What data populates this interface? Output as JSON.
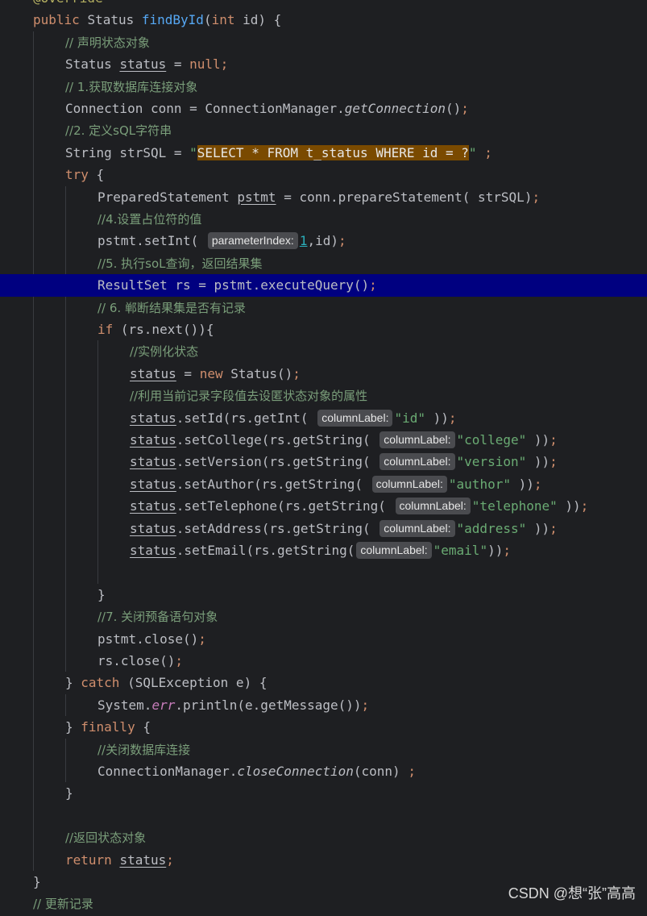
{
  "editor": {
    "lines": [
      {
        "indent": 0,
        "tokens": [
          {
            "t": "@Override",
            "c": "ann"
          }
        ]
      },
      {
        "indent": 0,
        "tokens": [
          {
            "t": "public ",
            "c": "kw"
          },
          {
            "t": "Status "
          },
          {
            "t": "findById",
            "c": "fn"
          },
          {
            "t": "("
          },
          {
            "t": "int ",
            "c": "kw"
          },
          {
            "t": "id) {"
          }
        ]
      },
      {
        "indent": 1,
        "tokens": [
          {
            "t": "// 声明状态对象",
            "c": "cm"
          }
        ]
      },
      {
        "indent": 1,
        "tokens": [
          {
            "t": "Status "
          },
          {
            "t": "status",
            "c": "ul"
          },
          {
            "t": " = "
          },
          {
            "t": "null",
            "c": "kw"
          },
          {
            "t": ";",
            "c": "kw"
          }
        ]
      },
      {
        "indent": 1,
        "tokens": [
          {
            "t": "// 1.获取数据库连接对象",
            "c": "cm"
          }
        ]
      },
      {
        "indent": 1,
        "tokens": [
          {
            "t": "Connection conn = ConnectionManager."
          },
          {
            "t": "getConnection",
            "c": "it"
          },
          {
            "t": "()"
          },
          {
            "t": ";",
            "c": "kw"
          }
        ]
      },
      {
        "indent": 1,
        "tokens": [
          {
            "t": "//2. 定义sQL字符串",
            "c": "cm"
          }
        ]
      },
      {
        "indent": 1,
        "tokens": [
          {
            "t": "String strSQL = "
          },
          {
            "t": "\"",
            "c": "str"
          },
          {
            "t": "SELECT * FROM t_status WHERE id = ?",
            "c": "hlstr"
          },
          {
            "t": "\"",
            "c": "str"
          },
          {
            "t": " ;",
            "c": "kw"
          }
        ]
      },
      {
        "indent": 1,
        "tokens": [
          {
            "t": "try",
            "c": "kw"
          },
          {
            "t": " {"
          }
        ]
      },
      {
        "indent": 2,
        "tokens": [
          {
            "t": "PreparedStatement "
          },
          {
            "t": "pstmt",
            "c": "ul"
          },
          {
            "t": " = conn.prepareStatement( strSQL)"
          },
          {
            "t": ";",
            "c": "kw"
          }
        ]
      },
      {
        "indent": 2,
        "tokens": [
          {
            "t": "//4.设置占位符的值",
            "c": "cm"
          }
        ]
      },
      {
        "indent": 2,
        "tokens": [
          {
            "t": "pstmt.setInt( "
          },
          {
            "t": "parameterIndex:",
            "c": "hint"
          },
          {
            "t": "1",
            "c": "num"
          },
          {
            "t": ",id)"
          },
          {
            "t": ";",
            "c": "kw"
          }
        ]
      },
      {
        "indent": 2,
        "tokens": [
          {
            "t": "//5. 执行soL查询，返回结果集",
            "c": "cm"
          }
        ]
      },
      {
        "indent": 2,
        "caret": true,
        "tokens": [
          {
            "t": "ResultSet rs = pstmt.executeQuery()"
          },
          {
            "t": ";",
            "c": "kw"
          }
        ]
      },
      {
        "indent": 2,
        "tokens": [
          {
            "t": "// 6. 郸断结果集是否有记录",
            "c": "cm"
          }
        ]
      },
      {
        "indent": 2,
        "tokens": [
          {
            "t": "if",
            "c": "kw"
          },
          {
            "t": " (rs.next()){"
          }
        ]
      },
      {
        "indent": 3,
        "tokens": [
          {
            "t": "//实例化状态",
            "c": "cm"
          }
        ]
      },
      {
        "indent": 3,
        "tokens": [
          {
            "t": "status",
            "c": "ul"
          },
          {
            "t": " = "
          },
          {
            "t": "new ",
            "c": "kw"
          },
          {
            "t": "Status()"
          },
          {
            "t": ";",
            "c": "kw"
          }
        ]
      },
      {
        "indent": 3,
        "tokens": [
          {
            "t": "//利用当前记录字段值去设匿状态对象的属性",
            "c": "cm"
          }
        ]
      },
      {
        "indent": 3,
        "tokens": [
          {
            "t": "status",
            "c": "ul"
          },
          {
            "t": ".setId(rs.getInt( "
          },
          {
            "t": "columnLabel:",
            "c": "hint"
          },
          {
            "t": "\"id\"",
            "c": "str"
          },
          {
            "t": " ))"
          },
          {
            "t": ";",
            "c": "kw"
          }
        ]
      },
      {
        "indent": 3,
        "tokens": [
          {
            "t": "status",
            "c": "ul"
          },
          {
            "t": ".setCollege(rs.getString( "
          },
          {
            "t": "columnLabel:",
            "c": "hint"
          },
          {
            "t": "\"college\"",
            "c": "str"
          },
          {
            "t": " ))"
          },
          {
            "t": ";",
            "c": "kw"
          }
        ]
      },
      {
        "indent": 3,
        "tokens": [
          {
            "t": "status",
            "c": "ul"
          },
          {
            "t": ".setVersion(rs.getString( "
          },
          {
            "t": "columnLabel:",
            "c": "hint"
          },
          {
            "t": "\"version\"",
            "c": "str"
          },
          {
            "t": " ))"
          },
          {
            "t": ";",
            "c": "kw"
          }
        ]
      },
      {
        "indent": 3,
        "tokens": [
          {
            "t": "status",
            "c": "ul"
          },
          {
            "t": ".setAuthor(rs.getString( "
          },
          {
            "t": "columnLabel:",
            "c": "hint"
          },
          {
            "t": "\"author\"",
            "c": "str"
          },
          {
            "t": " ))"
          },
          {
            "t": ";",
            "c": "kw"
          }
        ]
      },
      {
        "indent": 3,
        "tokens": [
          {
            "t": "status",
            "c": "ul"
          },
          {
            "t": ".setTelephone(rs.getString( "
          },
          {
            "t": "columnLabel:",
            "c": "hint"
          },
          {
            "t": "\"telephone\"",
            "c": "str"
          },
          {
            "t": " ))"
          },
          {
            "t": ";",
            "c": "kw"
          }
        ]
      },
      {
        "indent": 3,
        "tokens": [
          {
            "t": "status",
            "c": "ul"
          },
          {
            "t": ".setAddress(rs.getString( "
          },
          {
            "t": "columnLabel:",
            "c": "hint"
          },
          {
            "t": "\"address\"",
            "c": "str"
          },
          {
            "t": " ))"
          },
          {
            "t": ";",
            "c": "kw"
          }
        ]
      },
      {
        "indent": 3,
        "tokens": [
          {
            "t": "status",
            "c": "ul"
          },
          {
            "t": ".setEmail(rs.getString("
          },
          {
            "t": "columnLabel:",
            "c": "hint"
          },
          {
            "t": "\"email\"",
            "c": "str"
          },
          {
            "t": "))"
          },
          {
            "t": ";",
            "c": "kw"
          }
        ]
      },
      {
        "indent": 3,
        "tokens": []
      },
      {
        "indent": 2,
        "tokens": [
          {
            "t": "}"
          }
        ]
      },
      {
        "indent": 2,
        "tokens": [
          {
            "t": "//7. 关闭预备语句对象",
            "c": "cm"
          }
        ]
      },
      {
        "indent": 2,
        "tokens": [
          {
            "t": "pstmt.close()"
          },
          {
            "t": ";",
            "c": "kw"
          }
        ]
      },
      {
        "indent": 2,
        "tokens": [
          {
            "t": "rs.close()"
          },
          {
            "t": ";",
            "c": "kw"
          }
        ]
      },
      {
        "indent": 1,
        "tokens": [
          {
            "t": "} "
          },
          {
            "t": "catch",
            "c": "kw"
          },
          {
            "t": " (SQLException e) {"
          }
        ]
      },
      {
        "indent": 2,
        "tokens": [
          {
            "t": "System."
          },
          {
            "t": "err",
            "c": "st"
          },
          {
            "t": ".println(e.getMessage())"
          },
          {
            "t": ";",
            "c": "kw"
          }
        ]
      },
      {
        "indent": 1,
        "tokens": [
          {
            "t": "} "
          },
          {
            "t": "finally",
            "c": "kw"
          },
          {
            "t": " {"
          }
        ]
      },
      {
        "indent": 2,
        "tokens": [
          {
            "t": "//关闭数据库连接",
            "c": "cm"
          }
        ]
      },
      {
        "indent": 2,
        "tokens": [
          {
            "t": "ConnectionManager."
          },
          {
            "t": "closeConnection",
            "c": "it"
          },
          {
            "t": "(conn) "
          },
          {
            "t": ";",
            "c": "kw"
          }
        ]
      },
      {
        "indent": 1,
        "tokens": [
          {
            "t": "}"
          }
        ]
      },
      {
        "indent": 1,
        "tokens": []
      },
      {
        "indent": 1,
        "tokens": [
          {
            "t": "//返回状态对象",
            "c": "cm"
          }
        ]
      },
      {
        "indent": 1,
        "tokens": [
          {
            "t": "return ",
            "c": "kw"
          },
          {
            "t": "status",
            "c": "ul"
          },
          {
            "t": ";",
            "c": "kw"
          }
        ]
      },
      {
        "indent": 0,
        "tokens": [
          {
            "t": "}"
          }
        ]
      },
      {
        "indent": 0,
        "tokens": [
          {
            "t": "// 更新记录",
            "c": "cm"
          }
        ]
      }
    ]
  },
  "watermark": "CSDN @想“张”高高"
}
